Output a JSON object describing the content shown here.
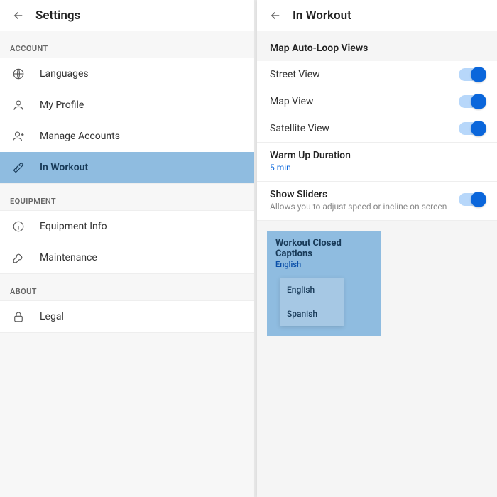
{
  "left": {
    "title": "Settings",
    "sections": {
      "account": {
        "label": "ACCOUNT",
        "items": [
          {
            "label": "Languages",
            "icon": "globe-icon"
          },
          {
            "label": "My Profile",
            "icon": "person-icon"
          },
          {
            "label": "Manage Accounts",
            "icon": "person-plus-icon"
          },
          {
            "label": "In Workout",
            "icon": "ruler-icon"
          }
        ]
      },
      "equipment": {
        "label": "EQUIPMENT",
        "items": [
          {
            "label": "Equipment Info",
            "icon": "info-icon"
          },
          {
            "label": "Maintenance",
            "icon": "wrench-icon"
          }
        ]
      },
      "about": {
        "label": "ABOUT",
        "items": [
          {
            "label": "Legal",
            "icon": "lock-icon"
          }
        ]
      }
    }
  },
  "right": {
    "title": "In Workout",
    "mapSectionTitle": "Map Auto-Loop Views",
    "toggles": [
      {
        "label": "Street View",
        "on": true
      },
      {
        "label": "Map View",
        "on": true
      },
      {
        "label": "Satellite View",
        "on": true
      }
    ],
    "warmup": {
      "title": "Warm Up Duration",
      "value": "5 min"
    },
    "sliders": {
      "title": "Show Sliders",
      "desc": "Allows you to adjust speed or incline on screen",
      "on": true
    },
    "captions": {
      "title": "Workout Closed Captions",
      "current": "English",
      "options": [
        "English",
        "Spanish"
      ]
    }
  }
}
